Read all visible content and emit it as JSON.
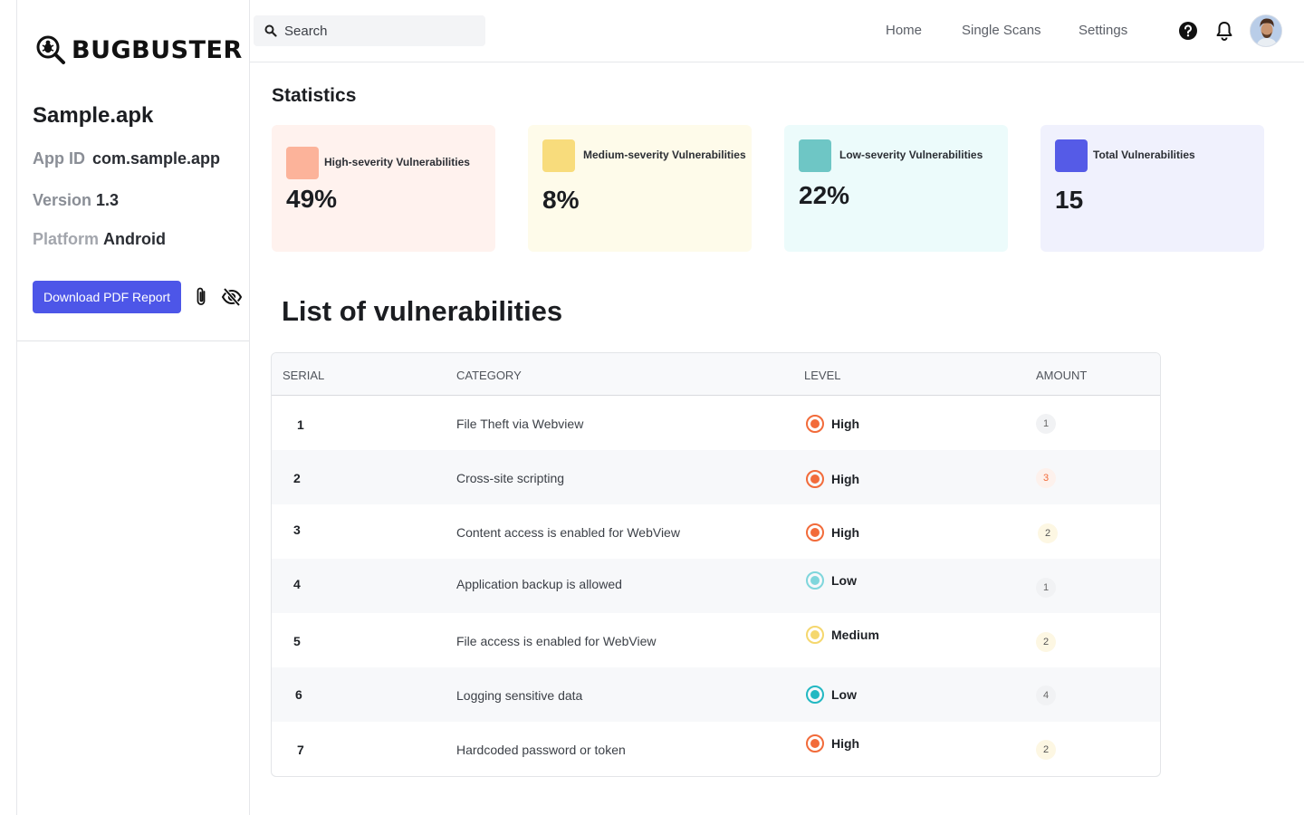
{
  "brand": {
    "name": "BUGBUSTER"
  },
  "app": {
    "name": "Sample.apk",
    "app_id_label": "App ID",
    "app_id": "com.sample.app",
    "version_label": "Version",
    "version": "1.3",
    "platform_label": "Platform",
    "platform": "Android"
  },
  "actions": {
    "download_label": "Download PDF Report"
  },
  "topbar": {
    "search_placeholder": "Search",
    "nav": {
      "home": "Home",
      "single_scans": "Single Scans",
      "settings": "Settings"
    }
  },
  "statistics": {
    "title": "Statistics",
    "high": {
      "label": "High-severity Vulnerabilities",
      "value": "49%"
    },
    "medium": {
      "label": "Medium-severity Vulnerabilities",
      "value": "8%"
    },
    "low": {
      "label": "Low-severity Vulnerabilities",
      "value": "22%"
    },
    "total": {
      "label": "Total Vulnerabilities",
      "value": "15"
    }
  },
  "list": {
    "title": "List of vulnerabilities",
    "columns": {
      "serial": "SERIAL",
      "category": "CATEGORY",
      "level": "LEVEL",
      "amount": "AMOUNT"
    },
    "rows": [
      {
        "serial": "1",
        "category": "File Theft via Webview",
        "level": "High",
        "amount": "1"
      },
      {
        "serial": "2",
        "category": "Cross-site scripting",
        "level": "High",
        "amount": "3"
      },
      {
        "serial": "3",
        "category": "Content access is enabled for WebView",
        "level": "High",
        "amount": "2"
      },
      {
        "serial": "4",
        "category": "Application backup is allowed",
        "level": "Low",
        "amount": "1"
      },
      {
        "serial": "5",
        "category": "File access is enabled for WebView",
        "level": "Medium",
        "amount": "2"
      },
      {
        "serial": "6",
        "category": "Logging sensitive data",
        "level": "Low",
        "amount": "4"
      },
      {
        "serial": "7",
        "category": "Hardcoded password or token",
        "level": "High",
        "amount": "2"
      }
    ]
  },
  "colors": {
    "accent": "#4d56e8",
    "high": "#f26b3a",
    "medium": "#f5d76e",
    "low_light": "#7fd6dc",
    "low": "#22b8c2"
  }
}
